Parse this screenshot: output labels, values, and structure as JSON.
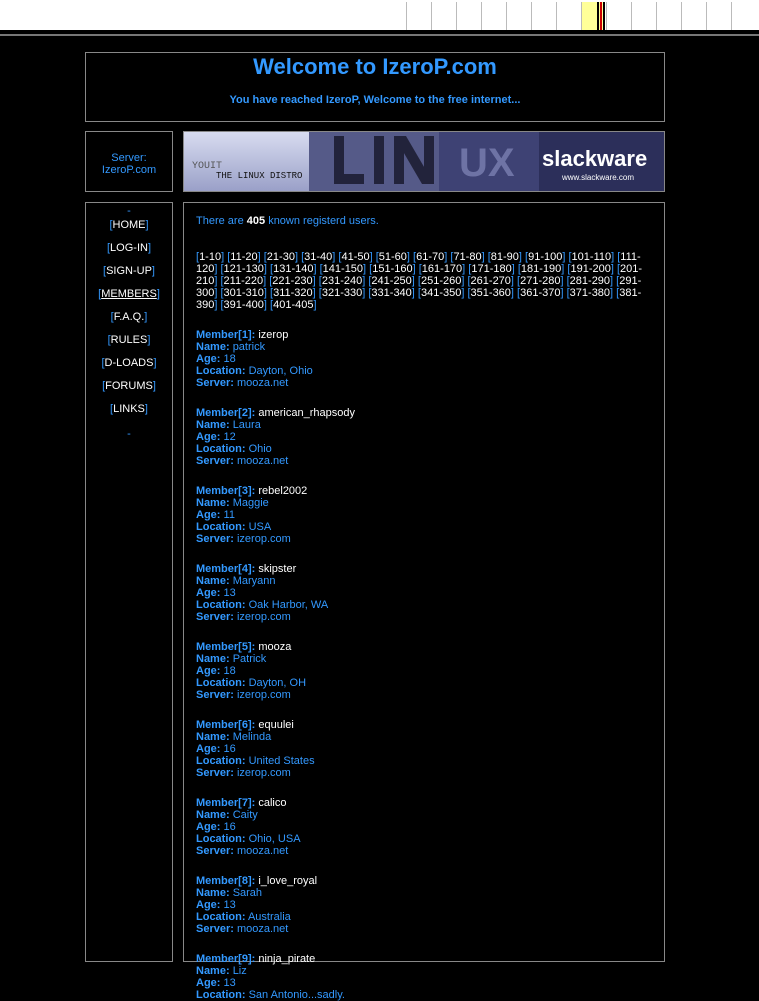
{
  "welcome": {
    "title": "Welcome to IzeroP.com",
    "subtitle": "You have reached IzeroP, Welcome to the free internet..."
  },
  "server_box": {
    "label": "Server:",
    "value": "IzeroP.com"
  },
  "banner": {
    "left_text": "THE LINUX DISTRO",
    "big_text": "LINUX",
    "brand": "slackware",
    "url": "www.slackware.com"
  },
  "nav": {
    "top_dash": "-",
    "items": [
      "HOME",
      "LOG-IN",
      "SIGN-UP",
      "MEMBERS",
      "F.A.Q.",
      "RULES",
      "D-LOADS",
      "FORUMS",
      "LINKS"
    ],
    "bottom_dash": "-"
  },
  "intro": {
    "prefix": "There are",
    "count": "405",
    "suffix": "known registerd users."
  },
  "pages": [
    "1-10",
    "11-20",
    "21-30",
    "31-40",
    "41-50",
    "51-60",
    "61-70",
    "71-80",
    "81-90",
    "91-100",
    "101-110",
    "111-120",
    "121-130",
    "131-140",
    "141-150",
    "151-160",
    "161-170",
    "171-180",
    "181-190",
    "191-200",
    "201-210",
    "211-220",
    "221-230",
    "231-240",
    "241-250",
    "251-260",
    "261-270",
    "271-280",
    "281-290",
    "291-300",
    "301-310",
    "311-320",
    "321-330",
    "331-340",
    "341-350",
    "351-360",
    "361-370",
    "371-380",
    "381-390",
    "391-400",
    "401-405"
  ],
  "member_fields": {
    "name": "Name:",
    "age": "Age:",
    "location": "Location:",
    "server": "Server:"
  },
  "members": [
    {
      "label": "Member[1]:",
      "handle": "izerop",
      "name": "patrick",
      "age": "18",
      "location": "Dayton, Ohio",
      "server": "mooza.net"
    },
    {
      "label": "Member[2]:",
      "handle": "american_rhapsody",
      "name": "Laura",
      "age": "12",
      "location": "Ohio",
      "server": "mooza.net"
    },
    {
      "label": "Member[3]:",
      "handle": "rebel2002",
      "name": "Maggie",
      "age": "11",
      "location": "USA",
      "server": "izerop.com"
    },
    {
      "label": "Member[4]:",
      "handle": "skipster",
      "name": "Maryann",
      "age": "13",
      "location": "Oak Harbor, WA",
      "server": "izerop.com"
    },
    {
      "label": "Member[5]:",
      "handle": "mooza",
      "name": "Patrick",
      "age": "18",
      "location": "Dayton, OH",
      "server": "izerop.com"
    },
    {
      "label": "Member[6]:",
      "handle": "equulei",
      "name": "Melinda",
      "age": "16",
      "location": "United States",
      "server": "izerop.com"
    },
    {
      "label": "Member[7]:",
      "handle": "calico",
      "name": "Caity",
      "age": "16",
      "location": "Ohio, USA",
      "server": "mooza.net"
    },
    {
      "label": "Member[8]:",
      "handle": "i_love_royal",
      "name": "Sarah",
      "age": "13",
      "location": "Australia",
      "server": "mooza.net"
    },
    {
      "label": "Member[9]:",
      "handle": "ninja_pirate",
      "name": "Liz",
      "age": "13",
      "location": "San Antonio...sadly.",
      "server": ""
    }
  ],
  "colors": {
    "background": "#000000",
    "accent": "#3399ff",
    "text": "#ffffff",
    "border": "#888888"
  }
}
